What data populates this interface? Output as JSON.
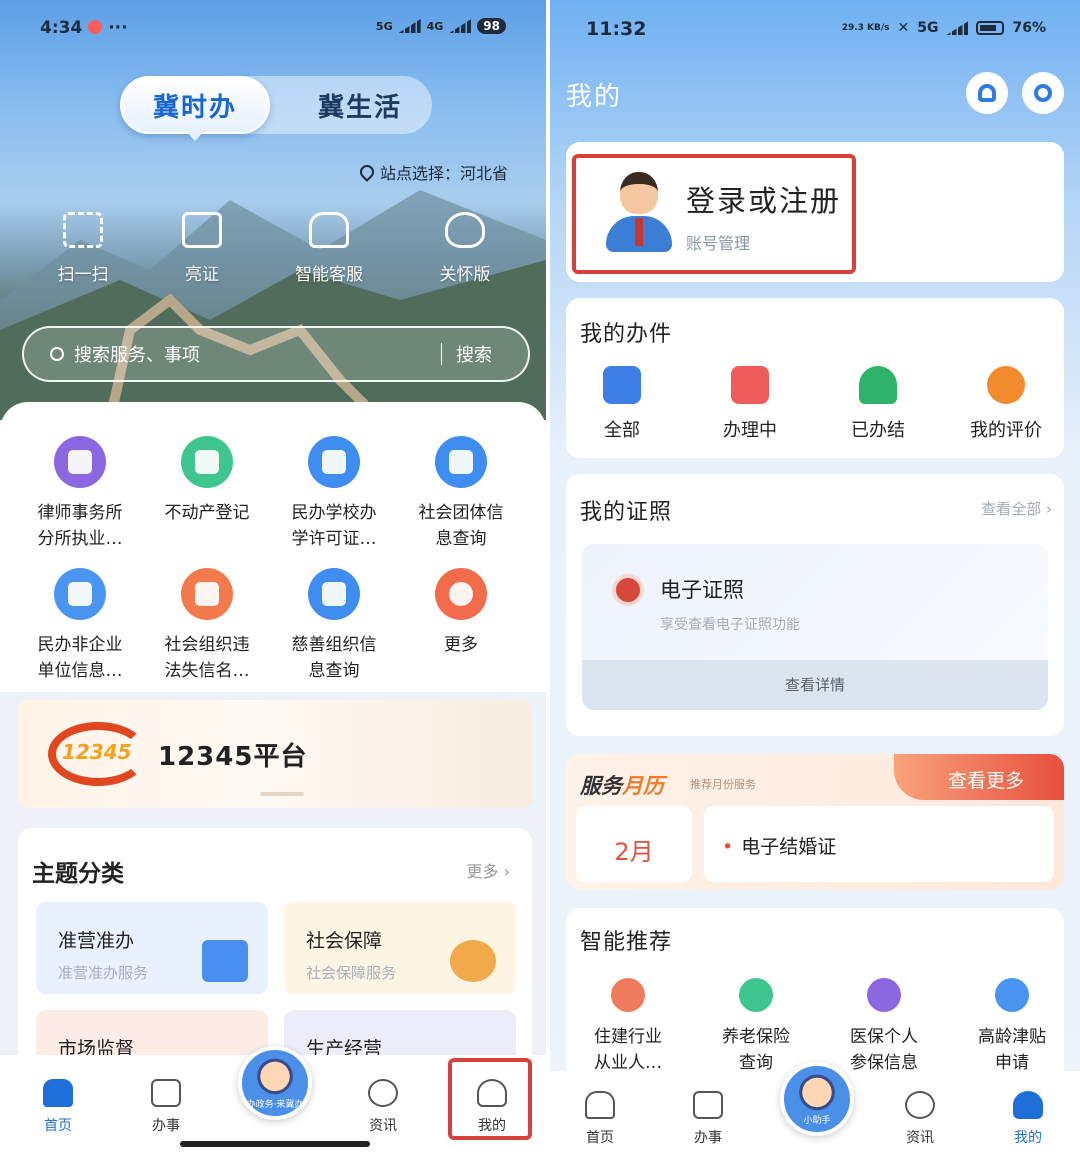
{
  "left": {
    "status": {
      "time": "4:34",
      "dots": "···",
      "signal": "5G",
      "signal2": "4G",
      "battery": "98"
    },
    "segment": {
      "active": "冀时办",
      "other": "冀生活"
    },
    "site": "站点选择：河北省",
    "quick_actions": [
      {
        "label": "扫一扫",
        "icon": "scan-icon"
      },
      {
        "label": "亮证",
        "icon": "id-card-icon"
      },
      {
        "label": "智能客服",
        "icon": "headset-icon"
      },
      {
        "label": "关怀版",
        "icon": "heart-hand-icon"
      }
    ],
    "search": {
      "placeholder": "搜索服务、事项",
      "button": "搜索"
    },
    "services": [
      {
        "line1": "律师事务所",
        "line2": "分所执业…",
        "color": "#8b67e0"
      },
      {
        "line1": "不动产登记",
        "line2": "",
        "color": "#3ec68e"
      },
      {
        "line1": "民办学校办",
        "line2": "学许可证…",
        "color": "#3f8df0"
      },
      {
        "line1": "社会团体信",
        "line2": "息查询",
        "color": "#3f8df0"
      },
      {
        "line1": "民办非企业",
        "line2": "单位信息…",
        "color": "#4a94f2"
      },
      {
        "line1": "社会组织违",
        "line2": "法失信名…",
        "color": "#f27a4d"
      },
      {
        "line1": "慈善组织信",
        "line2": "息查询",
        "color": "#3f8df0"
      },
      {
        "line1": "更多",
        "line2": "",
        "color": "#f26b4a"
      }
    ],
    "banner": {
      "logo": "12345",
      "title": "12345平台"
    },
    "topics": {
      "title": "主题分类",
      "more": "更多 ›",
      "cards": [
        {
          "title": "准营准办",
          "sub": "准营准办服务",
          "bg": "#e8f1fd",
          "deco": "#4a8ef0"
        },
        {
          "title": "社会保障",
          "sub": "社会保障服务",
          "bg": "#fdf4e3",
          "deco": "#f2a94a"
        },
        {
          "title": "市场监督",
          "sub": "",
          "bg": "#fdebe6",
          "deco": "#f07a5c"
        },
        {
          "title": "生产经营",
          "sub": "",
          "bg": "#ecedfb",
          "deco": "#7b86e8"
        }
      ]
    },
    "tabs": {
      "home": "首页",
      "affairs": "办事",
      "mascot": "办政务·来冀办",
      "news": "资讯",
      "mine": "我的"
    }
  },
  "right": {
    "status": {
      "time": "11:32",
      "speed": "29.3 KB/s",
      "signal": "5G",
      "battery": "76%"
    },
    "title": "我的",
    "login": {
      "title": "登录或注册",
      "sub": "账号管理"
    },
    "my_cases": {
      "title": "我的办件",
      "items": [
        {
          "label": "全部",
          "color": "#3d7fe6"
        },
        {
          "label": "办理中",
          "color": "#ef5a5a"
        },
        {
          "label": "已办结",
          "color": "#2fb36b"
        },
        {
          "label": "我的评价",
          "color": "#f28a2e"
        }
      ]
    },
    "licenses": {
      "title": "我的证照",
      "more": "查看全部 ›",
      "card_title": "电子证照",
      "card_sub": "享受查看电子证照功能",
      "detail": "查看详情"
    },
    "calendar": {
      "title_a": "服务",
      "title_b": "月历",
      "sub": "推荐月份服务",
      "more": "查看更多",
      "month": "2月",
      "item": "电子结婚证"
    },
    "recommend": {
      "title": "智能推荐",
      "items": [
        {
          "line1": "住建行业",
          "line2": "从业人…",
          "color": "#f07a5c"
        },
        {
          "line1": "养老保险",
          "line2": "查询",
          "color": "#3ec68e"
        },
        {
          "line1": "医保个人",
          "line2": "参保信息",
          "color": "#8b67e0"
        },
        {
          "line1": "高龄津贴",
          "line2": "申请",
          "color": "#4a94f2"
        }
      ]
    },
    "tabs": {
      "home": "首页",
      "affairs": "办事",
      "mascot": "小助手",
      "news": "资讯",
      "mine": "我的"
    }
  }
}
